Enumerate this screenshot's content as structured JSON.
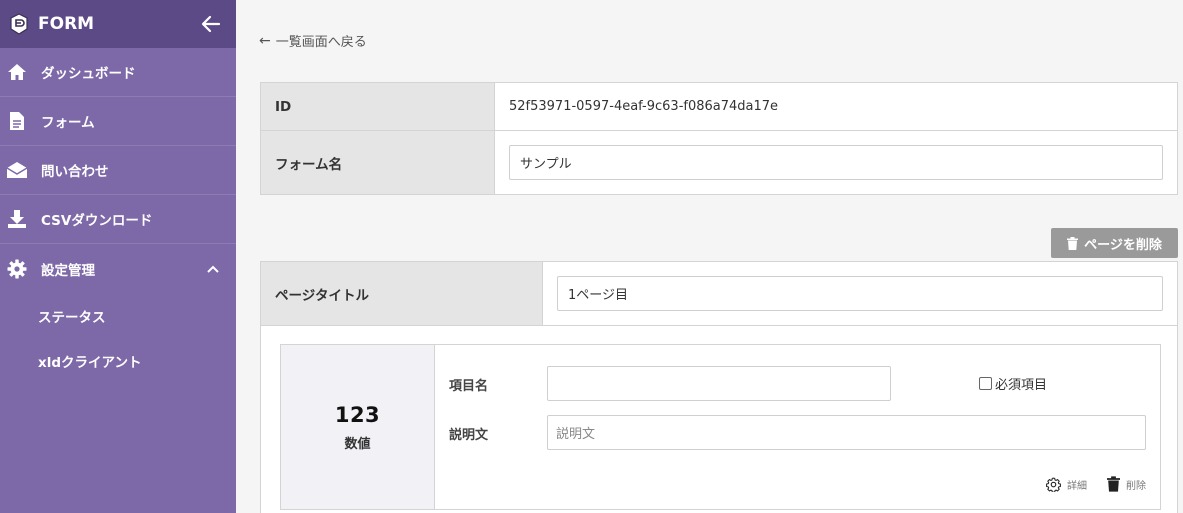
{
  "app": {
    "title": "FORM"
  },
  "sidebar": {
    "items": [
      {
        "label": "ダッシュボード",
        "icon": "home-icon"
      },
      {
        "label": "フォーム",
        "icon": "document-icon"
      },
      {
        "label": "問い合わせ",
        "icon": "envelope-icon"
      },
      {
        "label": "CSVダウンロード",
        "icon": "download-icon"
      },
      {
        "label": "設定管理",
        "icon": "gear-icon",
        "expanded": true
      }
    ],
    "subitems": [
      {
        "label": "ステータス"
      },
      {
        "label": "xldクライアント"
      }
    ]
  },
  "back_link": {
    "label": "一覧画面へ戻る"
  },
  "form_info": {
    "id_label": "ID",
    "id_value": "52f53971-0597-4eaf-9c63-f086a74da17e",
    "name_label": "フォーム名",
    "name_value": "サンプル"
  },
  "page": {
    "delete_label": "ページを削除",
    "title_label": "ページタイトル",
    "title_value": "1ページ目"
  },
  "field": {
    "type_icon_text": "123",
    "type_name": "数値",
    "item_name_label": "項目名",
    "item_name_value": "",
    "required_label": "必須項目",
    "required_checked": false,
    "description_label": "説明文",
    "description_placeholder": "説明文",
    "detail_label": "詳細",
    "delete_label": "削除"
  },
  "colors": {
    "sidebar": "#7d68a8",
    "sidebar_header": "#5c4a86",
    "button_gray": "#9a9a9a"
  }
}
